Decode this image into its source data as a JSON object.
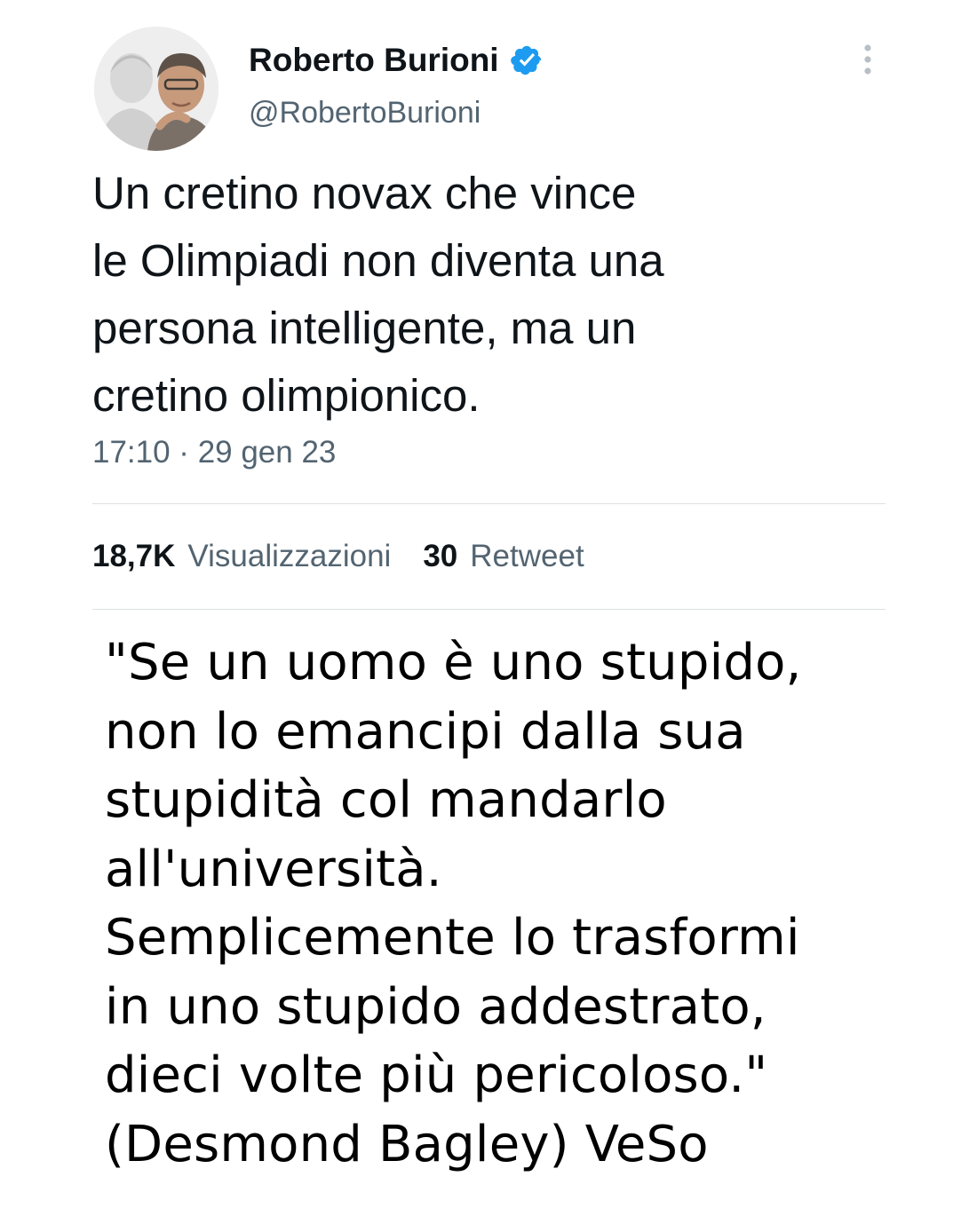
{
  "tweet": {
    "author": {
      "name": "Roberto Burioni",
      "handle": "@RobertoBurioni",
      "verified": true,
      "verified_icon": "verified-badge-icon"
    },
    "more_icon": "more-vertical-icon",
    "text": "Un cretino novax che vince\nle Olimpiadi non diventa una\npersona intelligente, ma un\ncretino olimpionico.",
    "timestamp": "17:10 · 29 gen 23",
    "stats": {
      "views_count": "18,7K",
      "views_label": "Visualizzazioni",
      "retweets_count": "30",
      "retweets_label": "Retweet"
    }
  },
  "quote": {
    "text": "\"Se un uomo è uno stupido,\nnon lo emancipi dalla sua\nstupidità col mandarlo\nall'università.\nSemplicemente lo trasformi\nin uno stupido addestrato,\ndieci volte più pericoloso.\"\n(Desmond Bagley) VeSo"
  },
  "colors": {
    "text_primary": "#0f1419",
    "text_secondary": "#536471",
    "verified_blue": "#1d9bf0",
    "divider": "#dde1e4",
    "quote_text": "#000000"
  }
}
